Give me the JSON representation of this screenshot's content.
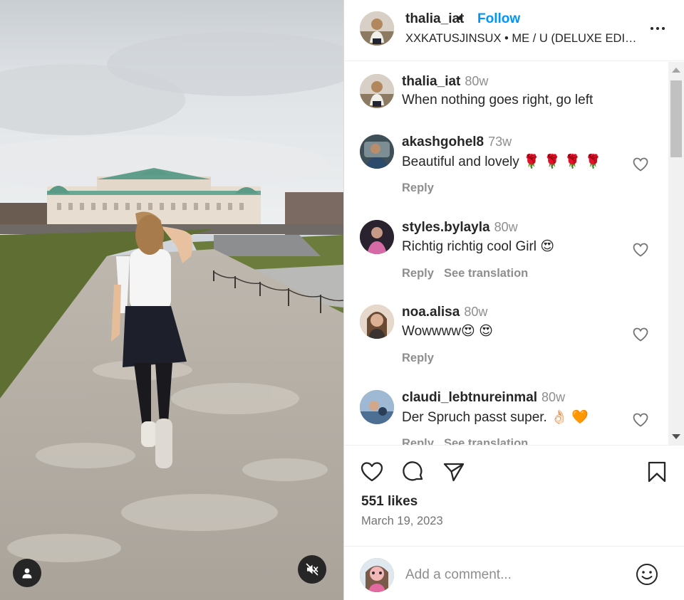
{
  "post": {
    "username": "thalia_iat",
    "separator": "•",
    "follow_label": "Follow",
    "audio": "XXKATUSJINSUX • ME / U (DELUXE EDITION)"
  },
  "comments": [
    {
      "user": "thalia_iat",
      "time": "80w",
      "text": "When nothing goes right, go left",
      "actions": []
    },
    {
      "user": "akashgohel8",
      "time": "73w",
      "text": "Beautiful and lovely 🌹 🌹 🌹 🌹",
      "actions": [
        "Reply"
      ]
    },
    {
      "user": "styles.bylayla",
      "time": "80w",
      "text": "Richtig richtig cool Girl 😍",
      "actions": [
        "Reply",
        "See translation"
      ]
    },
    {
      "user": "noa.alisa",
      "time": "80w",
      "text": "Wowwww😍 😍",
      "actions": [
        "Reply"
      ]
    },
    {
      "user": "claudi_lebtnureinmal",
      "time": "80w",
      "text": "Der Spruch passt super. 👌🏻 🧡",
      "actions": [
        "Reply",
        "See translation"
      ]
    }
  ],
  "stats": {
    "likes": "551 likes",
    "date": "March 19, 2023"
  },
  "composer": {
    "placeholder": "Add a comment..."
  },
  "icons": {
    "tag": "user-tag-icon",
    "mute": "audio-muted-icon",
    "more": "more-options-icon",
    "like": "heart-outline-icon",
    "comment": "comment-bubble-icon",
    "share": "paper-plane-icon",
    "save": "bookmark-icon",
    "emoji": "emoji-smile-icon"
  },
  "colors": {
    "accent": "#0095f6",
    "text": "#262626",
    "muted": "#8e8e8e"
  }
}
